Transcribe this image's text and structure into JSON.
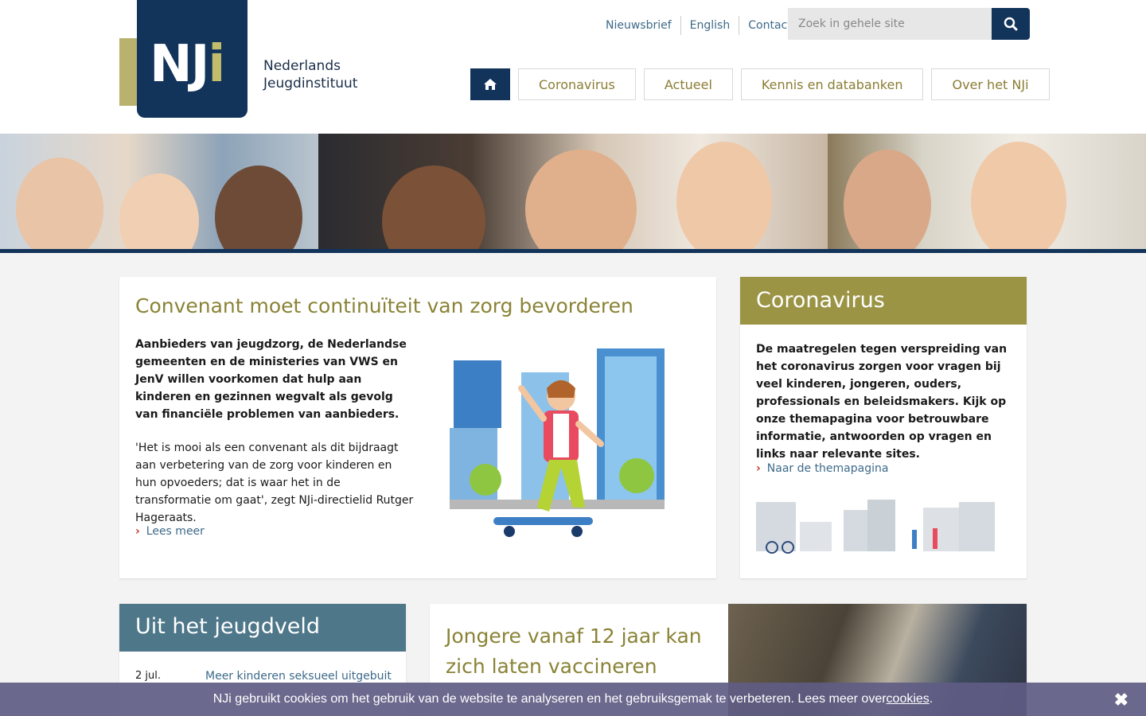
{
  "brand": {
    "logo_letters": "NJ",
    "logo_i": "i",
    "name_line1": "Nederlands",
    "name_line2": "Jeugdinstituut",
    "colors": {
      "navy": "#12335a",
      "gold": "#9b9445",
      "teal": "#4e7789"
    }
  },
  "util_nav": {
    "newsletter": "Nieuwsbrief",
    "english": "English",
    "contact": "Contact"
  },
  "search": {
    "placeholder": "Zoek in gehele site",
    "icon": "search-icon"
  },
  "main_nav": {
    "home_icon": "home-icon",
    "items": [
      {
        "label": "Coronavirus"
      },
      {
        "label": "Actueel"
      },
      {
        "label": "Kennis en databanken"
      },
      {
        "label": "Over het NJi"
      }
    ]
  },
  "feature": {
    "title": "Convenant moet continuïteit van zorg bevorderen",
    "lead": "Aanbieders van jeugdzorg, de Nederlandse gemeenten en de ministeries van VWS en JenV willen voorkomen dat hulp aan kinderen en gezinnen wegvalt als gevolg van financiële problemen van aanbieders.",
    "body": "'Het is mooi als een convenant als dit bijdraagt aan verbetering van de zorg voor kinderen en hun opvoeders; dat is waar het in de transformatie om gaat', zegt NJi-directielid Rutger Hageraats.",
    "more": "Lees meer"
  },
  "corona": {
    "title": "Coronavirus",
    "text": "De maatregelen tegen verspreiding van het coronavirus zorgen voor vragen bij veel kinderen, jongeren, ouders, professionals en beleidsmakers. Kijk op onze themapagina voor betrouwbare informatie, antwoorden op vragen en links naar relevante sites.",
    "link": "Naar de themapagina"
  },
  "jeugdveld": {
    "title": "Uit het jeugdveld",
    "items": [
      {
        "date": "2 jul.",
        "label": "Meer kinderen seksueel uitgebuit"
      }
    ]
  },
  "vaccination": {
    "title": "Jongere vanaf 12 jaar kan zich laten vaccineren"
  },
  "cookie": {
    "text": "NJi gebruikt cookies om het gebruik van de website te analyseren en het gebruiksgemak te verbeteren. Lees meer over ",
    "link": "cookies",
    "end": ".",
    "close_icon": "close-icon"
  }
}
